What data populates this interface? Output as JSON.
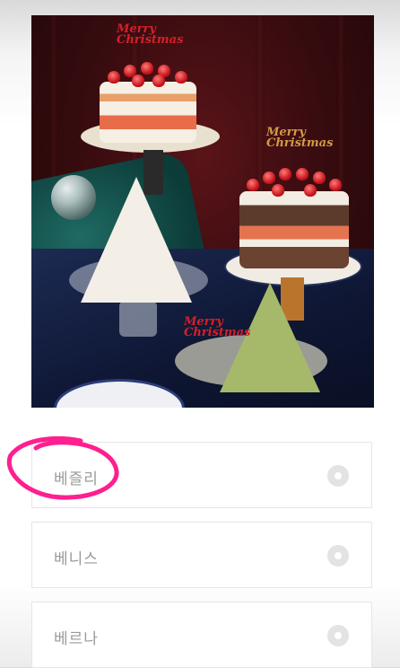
{
  "photo": {
    "alt_subject": "christmas-cakes-photo",
    "topper_text": "Merry Christmas"
  },
  "options": [
    {
      "label": "베즐리",
      "selected": false
    },
    {
      "label": "베니스",
      "selected": false
    },
    {
      "label": "베르나",
      "selected": false
    }
  ],
  "colors": {
    "annotation_pink": "#ff1f8e",
    "radio_gray": "#e3e3e3",
    "label_gray": "#9a9a9a"
  },
  "icons": {
    "radio": "radio-button-icon"
  }
}
